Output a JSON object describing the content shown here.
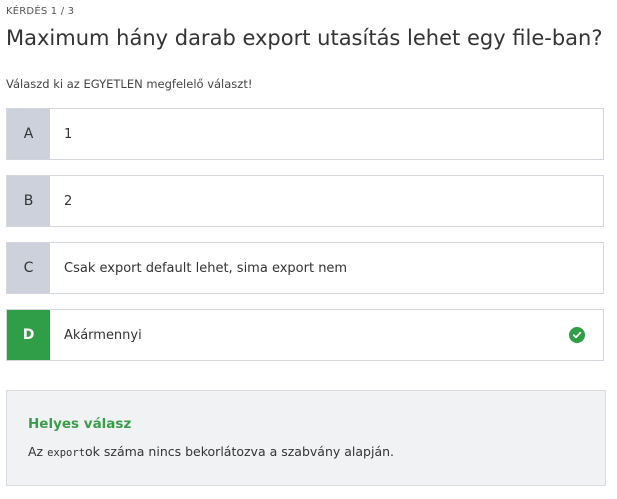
{
  "header": {
    "counter": "KÉRDÉS 1 / 3",
    "question": "Maximum hány darab export utasítás lehet egy file-ban?",
    "instruction": "Válaszd ki az EGYETLEN megfelelő választ!"
  },
  "options": [
    {
      "letter": "A",
      "text": "1",
      "state": "default"
    },
    {
      "letter": "B",
      "text": "2",
      "state": "default"
    },
    {
      "letter": "C",
      "text": "Csak export default lehet, sima export nem",
      "state": "default"
    },
    {
      "letter": "D",
      "text": "Akármennyi",
      "state": "correct-selected"
    }
  ],
  "feedback": {
    "title": "Helyes válasz",
    "code": "export",
    "text_after_code": "ok száma nincs bekorlátozva a szabvány alapján.",
    "text_before_code": "Az "
  },
  "icons": {
    "check": "check-circle-icon"
  },
  "colors": {
    "correct_green": "#2f9e46",
    "letter_bg": "#cdd1dc",
    "feedback_bg": "#f1f2f4",
    "feedback_title": "#3a9d4a"
  }
}
